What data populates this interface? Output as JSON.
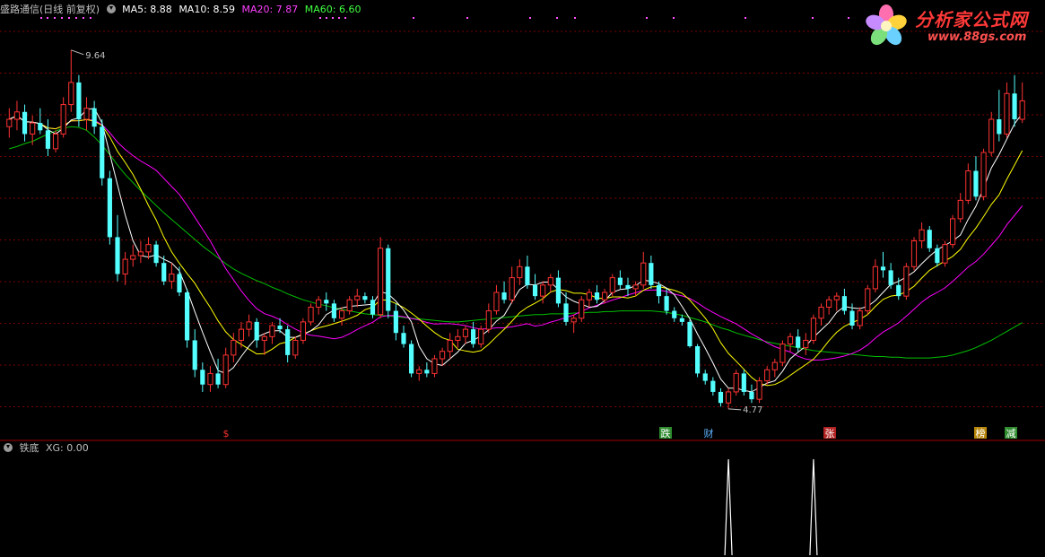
{
  "main_panel": {
    "stock_name": "盛路通信",
    "period": "(日线 前复权)",
    "indicators": [
      {
        "label": "MA5: 8.88",
        "color": "#ffffff"
      },
      {
        "label": "MA10: 8.59",
        "color": "#ffff00"
      },
      {
        "label": "MA20: 7.87",
        "color": "#ff00ff"
      },
      {
        "label": "MA60: 6.60",
        "color": "#00ff00"
      }
    ],
    "high_label": "9.64",
    "low_label": "4.77",
    "event_markers": [
      {
        "text": "$",
        "color": "#ff3030",
        "bg": ""
      },
      {
        "text": "跌",
        "color": "#ffffff",
        "bg": "#2e8b2e"
      },
      {
        "text": "财",
        "color": "#5fb2ff",
        "bg": ""
      },
      {
        "text": "张",
        "color": "#ffffff",
        "bg": "#b22222"
      },
      {
        "text": "榜",
        "color": "#ffffff",
        "bg": "#b8860b"
      },
      {
        "text": "减",
        "color": "#ffffff",
        "bg": "#2e8b2e"
      }
    ]
  },
  "sub_panel": {
    "indicator_name": "铁底",
    "value_label": "XG: 0.00"
  },
  "logo": {
    "text": "分析家公式网",
    "url_text": "www.88gs.com"
  },
  "colors": {
    "up": "#ff3232",
    "down": "#54ffff",
    "ma5": "#ffffff",
    "ma10": "#ffff00",
    "ma20": "#ff00ff",
    "ma60": "#00c000",
    "grid": "#7a0000"
  },
  "chart_data": {
    "type": "candlestick",
    "ohlc": [
      [
        8.6,
        8.85,
        8.45,
        8.7
      ],
      [
        8.7,
        8.95,
        8.55,
        8.8
      ],
      [
        8.8,
        8.9,
        8.4,
        8.5
      ],
      [
        8.5,
        8.75,
        8.35,
        8.65
      ],
      [
        8.65,
        8.85,
        8.5,
        8.55
      ],
      [
        8.55,
        8.7,
        8.2,
        8.3
      ],
      [
        8.3,
        8.55,
        8.25,
        8.5
      ],
      [
        8.5,
        9.0,
        8.45,
        8.9
      ],
      [
        8.9,
        9.64,
        8.8,
        9.2
      ],
      [
        9.2,
        9.3,
        8.6,
        8.7
      ],
      [
        8.7,
        9.0,
        8.55,
        8.85
      ],
      [
        8.85,
        8.95,
        8.5,
        8.6
      ],
      [
        8.6,
        8.7,
        7.8,
        7.9
      ],
      [
        7.9,
        8.0,
        7.0,
        7.1
      ],
      [
        7.1,
        7.4,
        6.5,
        6.6
      ],
      [
        6.6,
        6.9,
        6.45,
        6.8
      ],
      [
        6.8,
        7.0,
        6.7,
        6.85
      ],
      [
        6.85,
        7.05,
        6.75,
        6.9
      ],
      [
        6.9,
        7.1,
        6.8,
        7.0
      ],
      [
        7.0,
        7.05,
        6.7,
        6.75
      ],
      [
        6.75,
        6.85,
        6.45,
        6.5
      ],
      [
        6.5,
        6.75,
        6.4,
        6.6
      ],
      [
        6.6,
        6.7,
        6.3,
        6.35
      ],
      [
        6.35,
        6.4,
        5.6,
        5.7
      ],
      [
        5.7,
        5.85,
        5.2,
        5.3
      ],
      [
        5.3,
        5.4,
        5.0,
        5.1
      ],
      [
        5.1,
        5.35,
        5.0,
        5.25
      ],
      [
        5.25,
        5.45,
        5.05,
        5.1
      ],
      [
        5.1,
        5.6,
        5.05,
        5.5
      ],
      [
        5.5,
        5.8,
        5.4,
        5.7
      ],
      [
        5.7,
        5.95,
        5.6,
        5.85
      ],
      [
        5.85,
        6.05,
        5.75,
        5.95
      ],
      [
        5.95,
        6.0,
        5.6,
        5.7
      ],
      [
        5.7,
        5.8,
        5.5,
        5.75
      ],
      [
        5.75,
        5.95,
        5.65,
        5.9
      ],
      [
        5.9,
        6.0,
        5.8,
        5.85
      ],
      [
        5.85,
        5.9,
        5.4,
        5.5
      ],
      [
        5.5,
        5.75,
        5.45,
        5.7
      ],
      [
        5.7,
        6.0,
        5.65,
        5.95
      ],
      [
        5.95,
        6.2,
        5.9,
        6.15
      ],
      [
        6.15,
        6.3,
        6.05,
        6.25
      ],
      [
        6.25,
        6.35,
        6.1,
        6.2
      ],
      [
        6.2,
        6.25,
        5.95,
        6.0
      ],
      [
        6.0,
        6.15,
        5.9,
        6.1
      ],
      [
        6.1,
        6.3,
        6.05,
        6.25
      ],
      [
        6.25,
        6.4,
        6.15,
        6.3
      ],
      [
        6.3,
        6.35,
        6.2,
        6.25
      ],
      [
        6.25,
        6.3,
        6.0,
        6.05
      ],
      [
        6.05,
        7.1,
        6.0,
        6.95
      ],
      [
        6.95,
        7.0,
        6.0,
        6.1
      ],
      [
        6.1,
        6.2,
        5.7,
        5.8
      ],
      [
        5.8,
        5.9,
        5.6,
        5.65
      ],
      [
        5.65,
        5.7,
        5.2,
        5.25
      ],
      [
        5.25,
        5.35,
        5.15,
        5.3
      ],
      [
        5.3,
        5.4,
        5.2,
        5.25
      ],
      [
        5.25,
        5.5,
        5.2,
        5.45
      ],
      [
        5.45,
        5.6,
        5.35,
        5.55
      ],
      [
        5.55,
        5.8,
        5.45,
        5.7
      ],
      [
        5.7,
        5.85,
        5.6,
        5.75
      ],
      [
        5.75,
        5.9,
        5.65,
        5.85
      ],
      [
        5.85,
        5.95,
        5.6,
        5.65
      ],
      [
        5.65,
        5.9,
        5.6,
        5.85
      ],
      [
        5.85,
        6.2,
        5.8,
        6.1
      ],
      [
        6.1,
        6.45,
        6.05,
        6.35
      ],
      [
        6.35,
        6.5,
        6.2,
        6.25
      ],
      [
        6.25,
        6.7,
        6.2,
        6.55
      ],
      [
        6.55,
        6.8,
        6.45,
        6.7
      ],
      [
        6.7,
        6.85,
        6.4,
        6.45
      ],
      [
        6.45,
        6.6,
        6.25,
        6.3
      ],
      [
        6.3,
        6.5,
        6.2,
        6.45
      ],
      [
        6.45,
        6.6,
        6.35,
        6.55
      ],
      [
        6.55,
        6.65,
        6.15,
        6.2
      ],
      [
        6.2,
        6.35,
        5.9,
        5.95
      ],
      [
        5.95,
        6.05,
        5.8,
        6.0
      ],
      [
        6.0,
        6.3,
        5.95,
        6.25
      ],
      [
        6.25,
        6.4,
        6.15,
        6.35
      ],
      [
        6.35,
        6.45,
        6.2,
        6.25
      ],
      [
        6.25,
        6.4,
        6.2,
        6.35
      ],
      [
        6.35,
        6.6,
        6.3,
        6.55
      ],
      [
        6.55,
        6.65,
        6.4,
        6.45
      ],
      [
        6.45,
        6.55,
        6.3,
        6.4
      ],
      [
        6.4,
        6.5,
        6.3,
        6.45
      ],
      [
        6.45,
        6.9,
        6.4,
        6.75
      ],
      [
        6.75,
        6.85,
        6.4,
        6.45
      ],
      [
        6.45,
        6.5,
        6.2,
        6.3
      ],
      [
        6.3,
        6.4,
        6.05,
        6.1
      ],
      [
        6.1,
        6.15,
        5.95,
        6.0
      ],
      [
        6.0,
        6.05,
        5.9,
        5.95
      ],
      [
        5.95,
        5.98,
        5.6,
        5.62
      ],
      [
        5.62,
        5.65,
        5.2,
        5.25
      ],
      [
        5.25,
        5.3,
        5.1,
        5.15
      ],
      [
        5.15,
        5.2,
        4.95,
        5.0
      ],
      [
        5.0,
        5.05,
        4.8,
        4.85
      ],
      [
        4.85,
        5.05,
        4.77,
        5.0
      ],
      [
        5.0,
        5.3,
        4.95,
        5.25
      ],
      [
        5.25,
        5.3,
        4.95,
        5.0
      ],
      [
        5.0,
        5.1,
        4.85,
        4.9
      ],
      [
        4.9,
        5.2,
        4.85,
        5.15
      ],
      [
        5.15,
        5.35,
        5.1,
        5.3
      ],
      [
        5.3,
        5.45,
        5.2,
        5.4
      ],
      [
        5.4,
        5.7,
        5.35,
        5.65
      ],
      [
        5.65,
        5.8,
        5.55,
        5.75
      ],
      [
        5.75,
        5.85,
        5.55,
        5.6
      ],
      [
        5.6,
        5.8,
        5.5,
        5.7
      ],
      [
        5.7,
        6.05,
        5.65,
        6.0
      ],
      [
        6.0,
        6.2,
        5.9,
        6.15
      ],
      [
        6.15,
        6.3,
        6.05,
        6.25
      ],
      [
        6.25,
        6.35,
        6.1,
        6.3
      ],
      [
        6.3,
        6.4,
        6.05,
        6.1
      ],
      [
        6.1,
        6.2,
        5.85,
        5.9
      ],
      [
        5.9,
        6.15,
        5.85,
        6.1
      ],
      [
        6.1,
        6.45,
        6.05,
        6.4
      ],
      [
        6.4,
        6.8,
        6.35,
        6.7
      ],
      [
        6.7,
        6.9,
        6.55,
        6.65
      ],
      [
        6.65,
        6.75,
        6.4,
        6.45
      ],
      [
        6.45,
        6.55,
        6.25,
        6.3
      ],
      [
        6.3,
        6.75,
        6.25,
        6.7
      ],
      [
        6.7,
        7.1,
        6.65,
        7.05
      ],
      [
        7.05,
        7.3,
        6.95,
        7.2
      ],
      [
        7.2,
        7.25,
        6.9,
        6.95
      ],
      [
        6.95,
        7.0,
        6.7,
        6.75
      ],
      [
        6.75,
        7.05,
        6.7,
        7.0
      ],
      [
        7.0,
        7.4,
        6.95,
        7.35
      ],
      [
        7.35,
        7.7,
        7.3,
        7.6
      ],
      [
        7.6,
        8.1,
        7.55,
        8.0
      ],
      [
        8.0,
        8.2,
        7.6,
        7.65
      ],
      [
        7.65,
        8.3,
        7.6,
        8.25
      ],
      [
        8.25,
        8.8,
        8.2,
        8.7
      ],
      [
        8.7,
        9.1,
        8.4,
        8.5
      ],
      [
        8.5,
        9.2,
        8.45,
        9.05
      ],
      [
        9.05,
        9.3,
        8.6,
        8.7
      ],
      [
        8.7,
        9.2,
        8.65,
        8.95
      ]
    ],
    "ma60": [
      8.3,
      8.33,
      8.37,
      8.4,
      8.45,
      8.5,
      8.54,
      8.58,
      8.6,
      8.59,
      8.55,
      8.46,
      8.35,
      8.22,
      8.08,
      7.95,
      7.84,
      7.73,
      7.63,
      7.53,
      7.43,
      7.34,
      7.25,
      7.16,
      7.07,
      6.98,
      6.9,
      6.82,
      6.74,
      6.67,
      6.61,
      6.56,
      6.51,
      6.47,
      6.42,
      6.38,
      6.33,
      6.29,
      6.25,
      6.22,
      6.19,
      6.17,
      6.14,
      6.12,
      6.1,
      6.08,
      6.06,
      6.05,
      6.04,
      6.03,
      6.02,
      6.01,
      6.0,
      5.99,
      5.98,
      5.97,
      5.96,
      5.95,
      5.95,
      5.96,
      5.97,
      5.98,
      5.99,
      6.0,
      6.01,
      6.02,
      6.03,
      6.04,
      6.05,
      6.05,
      6.06,
      6.06,
      6.06,
      6.07,
      6.07,
      6.08,
      6.08,
      6.09,
      6.09,
      6.1,
      6.1,
      6.1,
      6.1,
      6.1,
      6.09,
      6.08,
      6.06,
      6.04,
      6.01,
      5.98,
      5.95,
      5.91,
      5.87,
      5.84,
      5.8,
      5.77,
      5.74,
      5.71,
      5.68,
      5.66,
      5.64,
      5.62,
      5.6,
      5.58,
      5.56,
      5.55,
      5.54,
      5.53,
      5.52,
      5.51,
      5.5,
      5.49,
      5.48,
      5.48,
      5.47,
      5.47,
      5.46,
      5.46,
      5.46,
      5.46,
      5.47,
      5.48,
      5.5,
      5.53,
      5.56,
      5.6,
      5.65,
      5.7,
      5.76,
      5.82,
      5.88,
      5.94
    ],
    "xg_spikes": [
      93,
      104
    ],
    "ylim": [
      4.5,
      10.1
    ]
  }
}
